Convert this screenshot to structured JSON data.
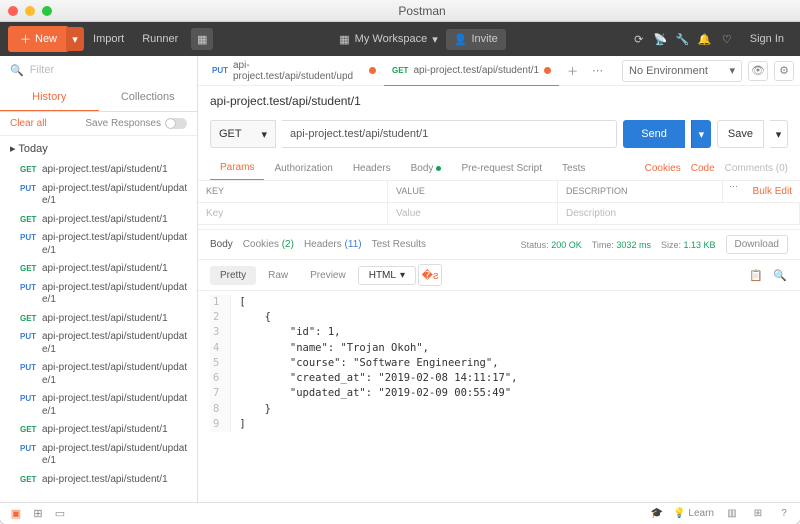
{
  "app_title": "Postman",
  "toolbar": {
    "new_label": "New",
    "import_label": "Import",
    "runner_label": "Runner",
    "workspace_label": "My Workspace",
    "invite_label": "Invite",
    "signin_label": "Sign In"
  },
  "sidebar": {
    "filter_placeholder": "Filter",
    "tab_history": "History",
    "tab_collections": "Collections",
    "clear_all": "Clear all",
    "save_responses": "Save Responses",
    "group_label": "Today",
    "items": [
      {
        "method": "GET",
        "url": "api-project.test/api/student/1"
      },
      {
        "method": "PUT",
        "url": "api-project.test/api/student/update/1"
      },
      {
        "method": "GET",
        "url": "api-project.test/api/student/1"
      },
      {
        "method": "PUT",
        "url": "api-project.test/api/student/update/1"
      },
      {
        "method": "GET",
        "url": "api-project.test/api/student/1"
      },
      {
        "method": "PUT",
        "url": "api-project.test/api/student/update/1"
      },
      {
        "method": "GET",
        "url": "api-project.test/api/student/1"
      },
      {
        "method": "PUT",
        "url": "api-project.test/api/student/update/1"
      },
      {
        "method": "PUT",
        "url": "api-project.test/api/student/update/1"
      },
      {
        "method": "PUT",
        "url": "api-project.test/api/student/update/1"
      },
      {
        "method": "GET",
        "url": "api-project.test/api/student/1"
      },
      {
        "method": "PUT",
        "url": "api-project.test/api/student/update/1"
      },
      {
        "method": "GET",
        "url": "api-project.test/api/student/1"
      }
    ]
  },
  "tabs": [
    {
      "method": "PUT",
      "label": "api-project.test/api/student/upd",
      "unsaved": true,
      "active": false,
      "method_color": "#3a7dd8"
    },
    {
      "method": "GET",
      "label": "api-project.test/api/student/1",
      "unsaved": true,
      "active": true,
      "method_color": "#1a9e5c"
    }
  ],
  "env": {
    "selected": "No Environment"
  },
  "request": {
    "title": "api-project.test/api/student/1",
    "method": "GET",
    "url": "api-project.test/api/student/1",
    "send": "Send",
    "save": "Save"
  },
  "sub_tabs": {
    "params": "Params",
    "auth": "Authorization",
    "headers": "Headers",
    "body": "Body",
    "prereq": "Pre-request Script",
    "tests": "Tests",
    "cookies": "Cookies",
    "code": "Code",
    "comments": "Comments (0)"
  },
  "param_head": {
    "key": "KEY",
    "value": "VALUE",
    "desc": "DESCRIPTION",
    "bulk": "Bulk Edit"
  },
  "param_row": {
    "key": "Key",
    "value": "Value",
    "desc": "Description"
  },
  "response": {
    "body": "Body",
    "cookies": "Cookies",
    "cookies_count": "(2)",
    "headers": "Headers",
    "headers_count": "(11)",
    "test_results": "Test Results",
    "status_lbl": "Status:",
    "status_val": "200 OK",
    "time_lbl": "Time:",
    "time_val": "3032 ms",
    "size_lbl": "Size:",
    "size_val": "1.13 KB",
    "download": "Download"
  },
  "view": {
    "pretty": "Pretty",
    "raw": "Raw",
    "preview": "Preview",
    "html": "HTML"
  },
  "response_body_lines": [
    "[",
    "    {",
    "        \"id\": 1,",
    "        \"name\": \"Trojan Okoh\",",
    "        \"course\": \"Software Engineering\",",
    "        \"created_at\": \"2019-02-08 14:11:17\",",
    "        \"updated_at\": \"2019-02-09 00:55:49\"",
    "    }",
    "]"
  ],
  "statusbar": {
    "learn": "Learn"
  }
}
